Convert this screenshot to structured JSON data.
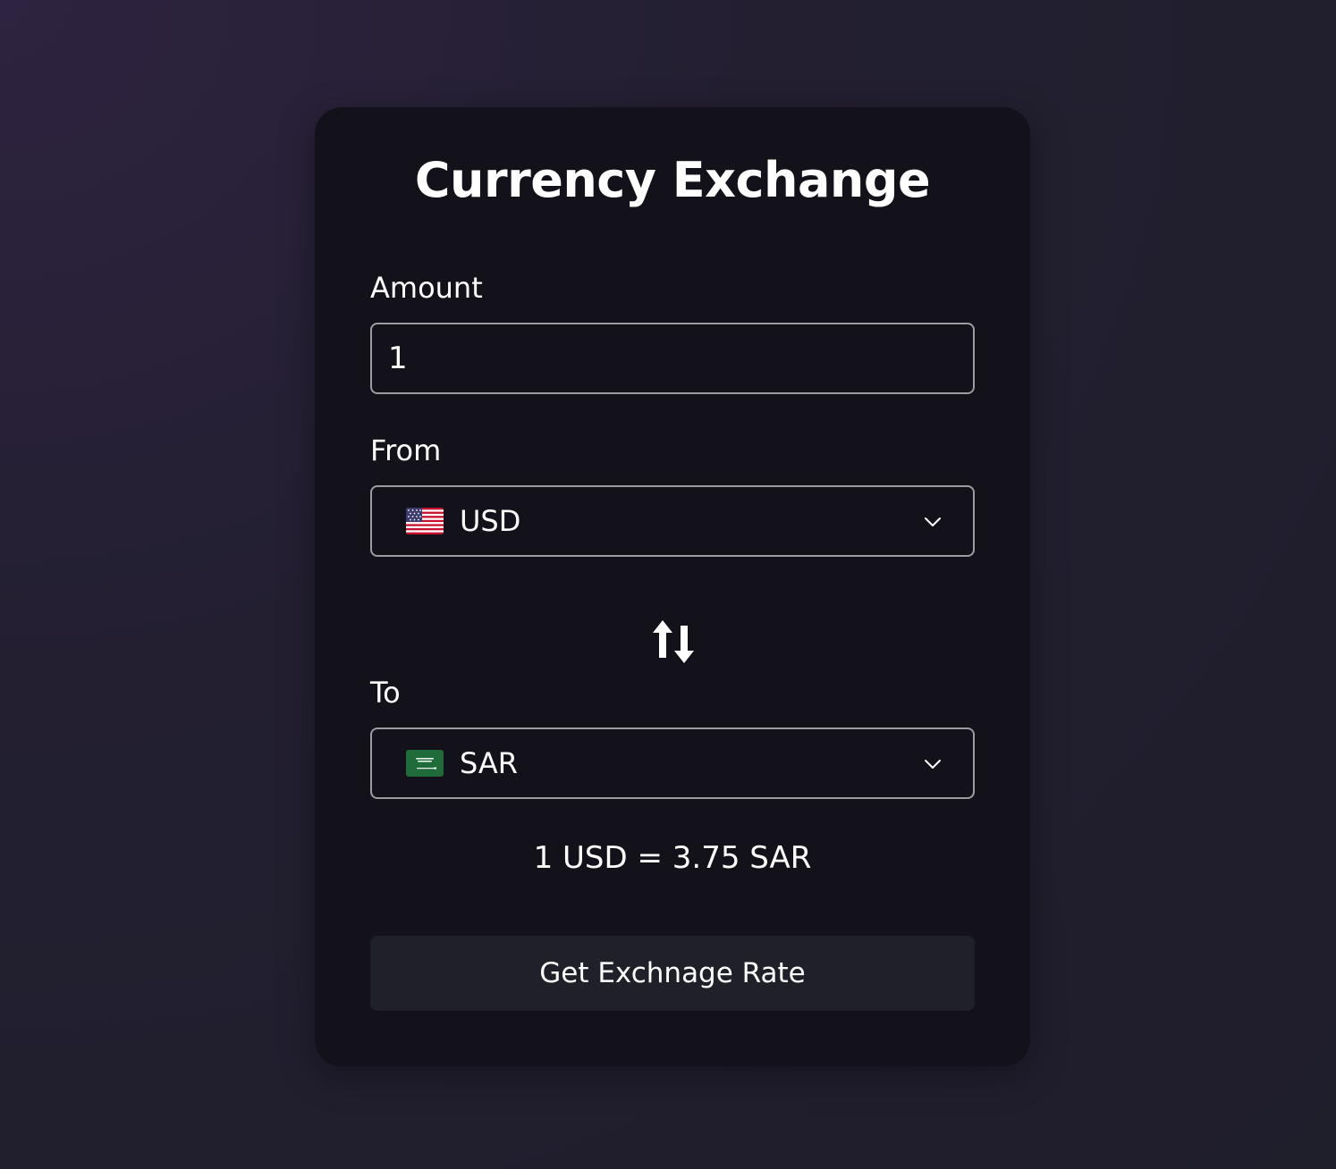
{
  "title": "Currency Exchange",
  "amount": {
    "label": "Amount",
    "value": "1"
  },
  "from": {
    "label": "From",
    "currency": "USD",
    "flag_icon": "us-flag-icon"
  },
  "to": {
    "label": "To",
    "currency": "SAR",
    "flag_icon": "sa-flag-icon"
  },
  "result": "1 USD = 3.75 SAR",
  "button_label": "Get Exchnage Rate",
  "colors": {
    "card": "#13121b",
    "button": "#1f2029",
    "border": "#9d9ca3",
    "text": "#ffffff"
  }
}
